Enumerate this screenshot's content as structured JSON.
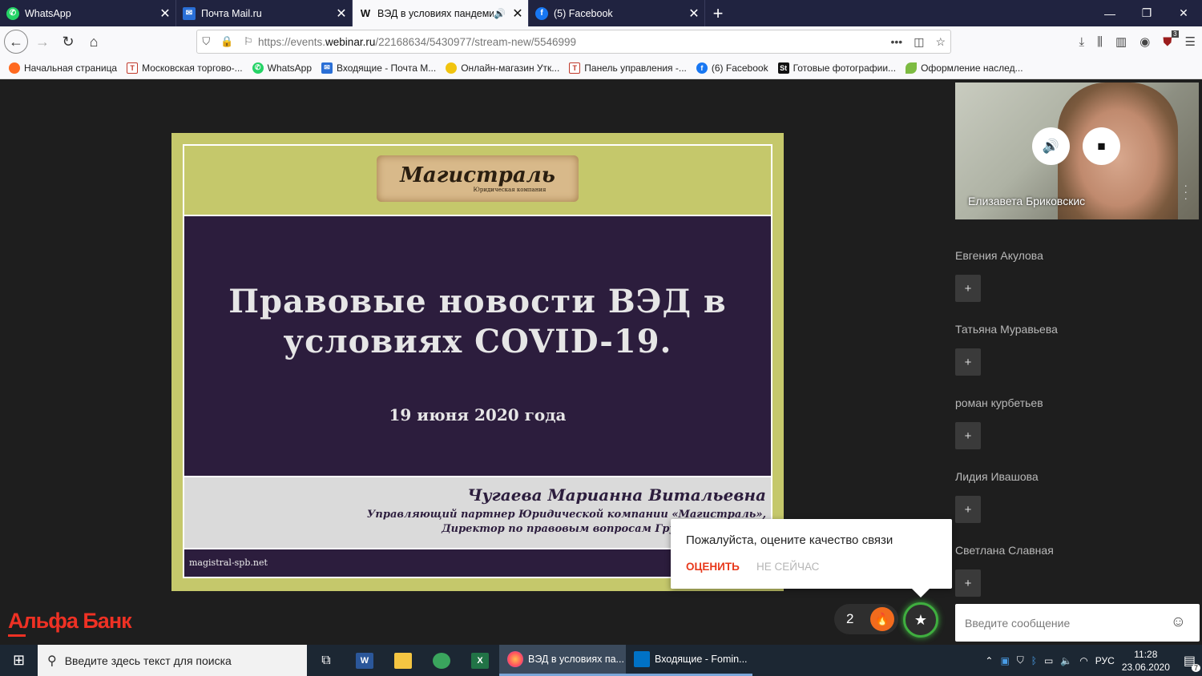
{
  "tabs": [
    {
      "label": "WhatsApp",
      "icon": "whatsapp-icon",
      "color": "#25d366",
      "glyph": "W",
      "active": false
    },
    {
      "label": "Почта Mail.ru",
      "icon": "mail-icon",
      "color": "#2a6fd6",
      "glyph": "@",
      "active": false
    },
    {
      "label": "ВЭД в условиях пандемии",
      "icon": "webinar-icon",
      "color": "#111111",
      "glyph": "W",
      "active": true
    },
    {
      "label": "(5) Facebook",
      "icon": "facebook-icon",
      "color": "#1877f2",
      "glyph": "f",
      "active": false
    }
  ],
  "address": {
    "prefix": "https://events.",
    "host": "webinar.ru",
    "path": "/22168634/5430977/stream-new/5546999"
  },
  "bookmarks": [
    {
      "label": "Начальная страница",
      "icon": "firefox-icon",
      "color": "#ff6a20",
      "glyph": ""
    },
    {
      "label": "Московская торгово-...",
      "icon": "chamber-icon",
      "color": "#c0392b",
      "glyph": "T"
    },
    {
      "label": "WhatsApp",
      "icon": "whatsapp-icon",
      "color": "#25d366",
      "glyph": "W"
    },
    {
      "label": "Входящие - Почта М...",
      "icon": "mail-icon",
      "color": "#2a6fd6",
      "glyph": "@"
    },
    {
      "label": "Онлайн-магазин Утк...",
      "icon": "duck-icon",
      "color": "#f1c40f",
      "glyph": ""
    },
    {
      "label": "Панель управления -...",
      "icon": "chamber-icon",
      "color": "#c0392b",
      "glyph": "T"
    },
    {
      "label": "(6) Facebook",
      "icon": "facebook-icon",
      "color": "#1877f2",
      "glyph": "f"
    },
    {
      "label": "Готовые фотографии...",
      "icon": "shutterstock-icon",
      "color": "#111111",
      "glyph": "St"
    },
    {
      "label": "Оформление наслед...",
      "icon": "leaf-icon",
      "color": "#7dbb42",
      "glyph": ""
    }
  ],
  "slide": {
    "logo_text": "Магистраль",
    "logo_sub": "Юридическая компания",
    "title_line1": "Правовые новости ВЭД в",
    "title_line2": "условиях COVID-19.",
    "date": "19 июня 2020 года",
    "author": "Чугаева Марианна Витальевна",
    "position1": "Управляющий партнер Юридической компании «Магистраль»,",
    "position2": "Директор по правовым вопросам Группы компаний",
    "site": "magistral-spb.net"
  },
  "popup": {
    "text": "Пожалуйста, оцените качество связи",
    "rate": "ОЦЕНИТЬ",
    "later": "НЕ СЕЙЧАС"
  },
  "brand": "Альфа Банк",
  "counter": "2",
  "video": {
    "name": "Елизавета Бриковскис"
  },
  "participants": [
    {
      "name": "Евгения Акулова"
    },
    {
      "name": "Татьяна Муравьева"
    },
    {
      "name": "роман курбетьев"
    },
    {
      "name": "Лидия Ивашова"
    },
    {
      "name": "Светлана Славная"
    }
  ],
  "add_label": "+",
  "message": {
    "placeholder": "Введите сообщение"
  },
  "taskbar": {
    "search": "Введите здесь текст для поиска",
    "firefox_task": "ВЭД в условиях па...",
    "outlook_task": "Входящие - Fomin...",
    "lang": "РУС",
    "time": "11:28",
    "date": "23.06.2020",
    "notifications": "7"
  },
  "accent_color": "#ef3124",
  "ublock_badge": "3"
}
